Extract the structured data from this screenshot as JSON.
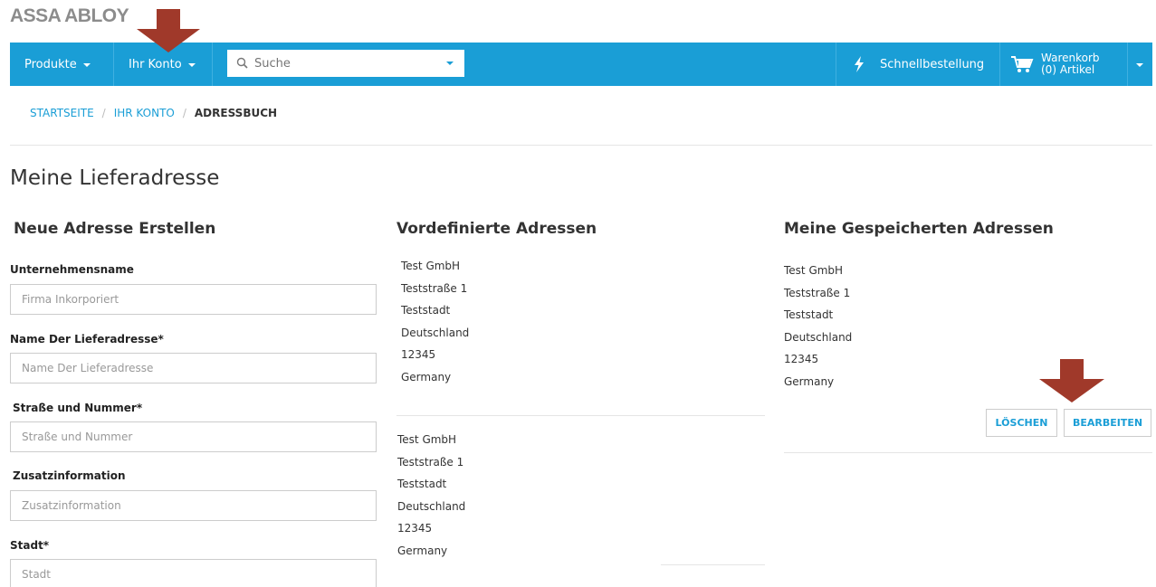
{
  "brand": {
    "logo": "ASSA ABLOY"
  },
  "nav": {
    "produkte": "Produkte",
    "ihr_konto": "Ihr Konto",
    "search_placeholder": "Suche",
    "schnellbestellung": "Schnellbestellung",
    "warenkorb": "Warenkorb",
    "warenkorb_count": "(0) Artikel"
  },
  "breadcrumb": {
    "home": "STARTSEITE",
    "sep": "/",
    "account": "IHR KONTO",
    "current": "ADRESSBUCH"
  },
  "page_title": "Meine Lieferadresse",
  "new_address": {
    "heading": "Neue Adresse Erstellen",
    "fields": [
      {
        "label": "Unternehmensname",
        "placeholder": "Firma Inkorporiert"
      },
      {
        "label": "Name Der Lieferadresse*",
        "placeholder": "Name Der Lieferadresse"
      },
      {
        "label": "Straße und Nummer*",
        "placeholder": "Straße und Nummer"
      },
      {
        "label": "Zusatzinformation",
        "placeholder": "Zusatzinformation"
      },
      {
        "label": "Stadt*",
        "placeholder": "Stadt"
      }
    ]
  },
  "predefined": {
    "heading": "Vordefinierte Adressen",
    "addresses": [
      {
        "company": "Test GmbH",
        "street": "Teststraße 1",
        "city": "Teststadt",
        "region": "Deutschland",
        "zip": "12345",
        "country": "Germany"
      },
      {
        "company": "Test GmbH",
        "street": "Teststraße 1",
        "city": "Teststadt",
        "region": "Deutschland",
        "zip": "12345",
        "country": "Germany"
      }
    ]
  },
  "saved": {
    "heading": "Meine Gespeicherten Adressen",
    "address": {
      "company": "Test GmbH",
      "street": "Teststraße 1",
      "city": "Teststadt",
      "region": "Deutschland",
      "zip": "12345",
      "country": "Germany"
    },
    "delete_label": "LÖSCHEN",
    "edit_label": "BEARBEITEN"
  },
  "colors": {
    "primary": "#1a9ed6",
    "annotation_arrow": "#a0392a"
  }
}
